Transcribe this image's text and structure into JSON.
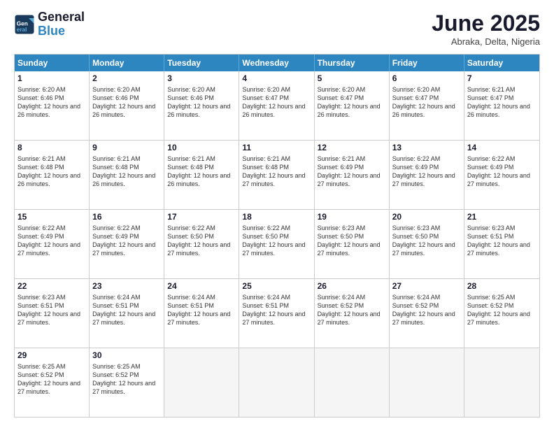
{
  "logo": {
    "line1": "General",
    "line2": "Blue"
  },
  "title": "June 2025",
  "location": "Abraka, Delta, Nigeria",
  "dayNames": [
    "Sunday",
    "Monday",
    "Tuesday",
    "Wednesday",
    "Thursday",
    "Friday",
    "Saturday"
  ],
  "weeks": [
    [
      {
        "day": "1",
        "sunrise": "6:20 AM",
        "sunset": "6:46 PM",
        "daylight": "12 hours and 26 minutes."
      },
      {
        "day": "2",
        "sunrise": "6:20 AM",
        "sunset": "6:46 PM",
        "daylight": "12 hours and 26 minutes."
      },
      {
        "day": "3",
        "sunrise": "6:20 AM",
        "sunset": "6:46 PM",
        "daylight": "12 hours and 26 minutes."
      },
      {
        "day": "4",
        "sunrise": "6:20 AM",
        "sunset": "6:47 PM",
        "daylight": "12 hours and 26 minutes."
      },
      {
        "day": "5",
        "sunrise": "6:20 AM",
        "sunset": "6:47 PM",
        "daylight": "12 hours and 26 minutes."
      },
      {
        "day": "6",
        "sunrise": "6:20 AM",
        "sunset": "6:47 PM",
        "daylight": "12 hours and 26 minutes."
      },
      {
        "day": "7",
        "sunrise": "6:21 AM",
        "sunset": "6:47 PM",
        "daylight": "12 hours and 26 minutes."
      }
    ],
    [
      {
        "day": "8",
        "sunrise": "6:21 AM",
        "sunset": "6:48 PM",
        "daylight": "12 hours and 26 minutes."
      },
      {
        "day": "9",
        "sunrise": "6:21 AM",
        "sunset": "6:48 PM",
        "daylight": "12 hours and 26 minutes."
      },
      {
        "day": "10",
        "sunrise": "6:21 AM",
        "sunset": "6:48 PM",
        "daylight": "12 hours and 26 minutes."
      },
      {
        "day": "11",
        "sunrise": "6:21 AM",
        "sunset": "6:48 PM",
        "daylight": "12 hours and 27 minutes."
      },
      {
        "day": "12",
        "sunrise": "6:21 AM",
        "sunset": "6:49 PM",
        "daylight": "12 hours and 27 minutes."
      },
      {
        "day": "13",
        "sunrise": "6:22 AM",
        "sunset": "6:49 PM",
        "daylight": "12 hours and 27 minutes."
      },
      {
        "day": "14",
        "sunrise": "6:22 AM",
        "sunset": "6:49 PM",
        "daylight": "12 hours and 27 minutes."
      }
    ],
    [
      {
        "day": "15",
        "sunrise": "6:22 AM",
        "sunset": "6:49 PM",
        "daylight": "12 hours and 27 minutes."
      },
      {
        "day": "16",
        "sunrise": "6:22 AM",
        "sunset": "6:49 PM",
        "daylight": "12 hours and 27 minutes."
      },
      {
        "day": "17",
        "sunrise": "6:22 AM",
        "sunset": "6:50 PM",
        "daylight": "12 hours and 27 minutes."
      },
      {
        "day": "18",
        "sunrise": "6:22 AM",
        "sunset": "6:50 PM",
        "daylight": "12 hours and 27 minutes."
      },
      {
        "day": "19",
        "sunrise": "6:23 AM",
        "sunset": "6:50 PM",
        "daylight": "12 hours and 27 minutes."
      },
      {
        "day": "20",
        "sunrise": "6:23 AM",
        "sunset": "6:50 PM",
        "daylight": "12 hours and 27 minutes."
      },
      {
        "day": "21",
        "sunrise": "6:23 AM",
        "sunset": "6:51 PM",
        "daylight": "12 hours and 27 minutes."
      }
    ],
    [
      {
        "day": "22",
        "sunrise": "6:23 AM",
        "sunset": "6:51 PM",
        "daylight": "12 hours and 27 minutes."
      },
      {
        "day": "23",
        "sunrise": "6:24 AM",
        "sunset": "6:51 PM",
        "daylight": "12 hours and 27 minutes."
      },
      {
        "day": "24",
        "sunrise": "6:24 AM",
        "sunset": "6:51 PM",
        "daylight": "12 hours and 27 minutes."
      },
      {
        "day": "25",
        "sunrise": "6:24 AM",
        "sunset": "6:51 PM",
        "daylight": "12 hours and 27 minutes."
      },
      {
        "day": "26",
        "sunrise": "6:24 AM",
        "sunset": "6:52 PM",
        "daylight": "12 hours and 27 minutes."
      },
      {
        "day": "27",
        "sunrise": "6:24 AM",
        "sunset": "6:52 PM",
        "daylight": "12 hours and 27 minutes."
      },
      {
        "day": "28",
        "sunrise": "6:25 AM",
        "sunset": "6:52 PM",
        "daylight": "12 hours and 27 minutes."
      }
    ],
    [
      {
        "day": "29",
        "sunrise": "6:25 AM",
        "sunset": "6:52 PM",
        "daylight": "12 hours and 27 minutes."
      },
      {
        "day": "30",
        "sunrise": "6:25 AM",
        "sunset": "6:52 PM",
        "daylight": "12 hours and 27 minutes."
      },
      null,
      null,
      null,
      null,
      null
    ]
  ]
}
